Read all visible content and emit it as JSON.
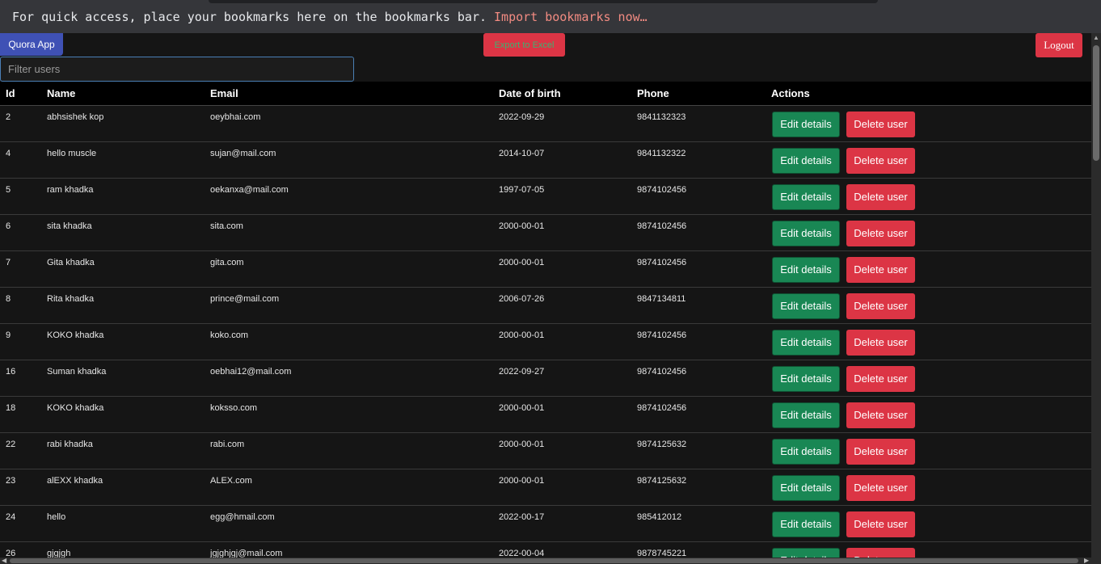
{
  "bookmarks_bar": {
    "message": "For quick access, place your bookmarks here on the bookmarks bar.",
    "import_link": "Import bookmarks now…"
  },
  "navbar": {
    "brand": "Quora App",
    "export_label": "Export to Excel",
    "logout_label": "Logout"
  },
  "filter": {
    "placeholder": "Filter users",
    "value": ""
  },
  "table": {
    "columns": [
      "Id",
      "Name",
      "Email",
      "Date of birth",
      "Phone",
      "Actions"
    ],
    "edit_label": "Edit details",
    "delete_label": "Delete user",
    "rows": [
      {
        "id": "2",
        "name": "abhsishek kop",
        "email": "oeybhai.com",
        "dob": "2022-09-29",
        "phone": "9841132323"
      },
      {
        "id": "4",
        "name": "hello muscle",
        "email": "sujan@mail.com",
        "dob": "2014-10-07",
        "phone": "9841132322"
      },
      {
        "id": "5",
        "name": "ram khadka",
        "email": "oekanxa@mail.com",
        "dob": "1997-07-05",
        "phone": "9874102456"
      },
      {
        "id": "6",
        "name": "sita khadka",
        "email": "sita.com",
        "dob": "2000-00-01",
        "phone": "9874102456"
      },
      {
        "id": "7",
        "name": "Gita khadka",
        "email": "gita.com",
        "dob": "2000-00-01",
        "phone": "9874102456"
      },
      {
        "id": "8",
        "name": "Rita khadka",
        "email": "prince@mail.com",
        "dob": "2006-07-26",
        "phone": "9847134811"
      },
      {
        "id": "9",
        "name": "KOKO khadka",
        "email": "koko.com",
        "dob": "2000-00-01",
        "phone": "9874102456"
      },
      {
        "id": "16",
        "name": "Suman khadka",
        "email": "oebhai12@mail.com",
        "dob": "2022-09-27",
        "phone": "9874102456"
      },
      {
        "id": "18",
        "name": "KOKO khadka",
        "email": "koksso.com",
        "dob": "2000-00-01",
        "phone": "9874102456"
      },
      {
        "id": "22",
        "name": "rabi khadka",
        "email": "rabi.com",
        "dob": "2000-00-01",
        "phone": "9874125632"
      },
      {
        "id": "23",
        "name": "alEXX khadka",
        "email": "ALEX.com",
        "dob": "2000-00-01",
        "phone": "9874125632"
      },
      {
        "id": "24",
        "name": "hello",
        "email": "egg@hmail.com",
        "dob": "2022-00-17",
        "phone": "985412012"
      },
      {
        "id": "26",
        "name": "gjgjgh",
        "email": "jgjghjgj@mail.com",
        "dob": "2022-00-04",
        "phone": "9878745221"
      }
    ]
  },
  "colors": {
    "background": "#151515",
    "edit_button": "#198754",
    "delete_button": "#dc3545",
    "brand": "#3f51b5"
  }
}
